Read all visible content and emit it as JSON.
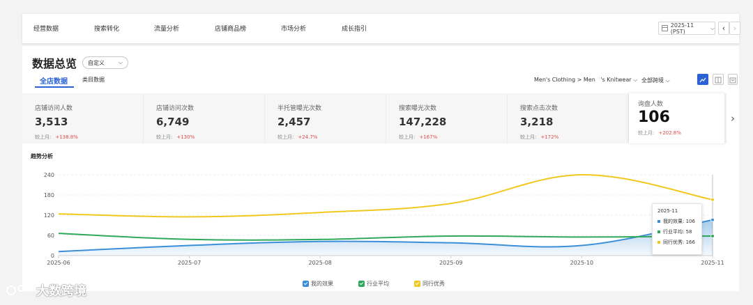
{
  "nav": {
    "tabs": [
      "经营数据",
      "搜索转化",
      "流量分析",
      "店铺商品榜",
      "市场分析",
      "成长指引"
    ],
    "month_picker": "2025-11 (PST)",
    "prev_label": "‹",
    "next_label": "›"
  },
  "header": {
    "title": "数据总览",
    "range_select": "自定义",
    "sub_tabs": [
      "全店数据",
      "类目数据"
    ],
    "category_filter": "Men's Clothing > Men   's Knitwear",
    "cross_filter": "全部跨境"
  },
  "metrics": [
    {
      "label": "店铺访问人数",
      "value": "3,513",
      "compare_label": "较上月:",
      "change": "+138.8%"
    },
    {
      "label": "店铺访问次数",
      "value": "6,749",
      "compare_label": "较上月:",
      "change": "+130%"
    },
    {
      "label": "半托管曝光次数",
      "value": "2,457",
      "compare_label": "较上月:",
      "change": "+24.7%"
    },
    {
      "label": "搜索曝光次数",
      "value": "147,228",
      "compare_label": "较上月:",
      "change": "+167%"
    },
    {
      "label": "搜索点击次数",
      "value": "3,218",
      "compare_label": "较上月:",
      "change": "+172%"
    },
    {
      "label": "询盘人数",
      "value": "106",
      "compare_label": "较上月:",
      "change": "+202.8%"
    }
  ],
  "metric_next_label": "›",
  "trend": {
    "title": "趋势分析"
  },
  "colors": {
    "mine": "#3b8fd8",
    "industry": "#2ea85a",
    "peer": "#f2c81f",
    "accent": "#2a62d4",
    "up": "#e24a4a"
  },
  "chart_data": {
    "type": "line",
    "x": [
      "2025-06",
      "2025-07",
      "2025-08",
      "2025-09",
      "2025-10",
      "2025-11"
    ],
    "ylim": [
      0,
      240
    ],
    "yticks": [
      0,
      60,
      120,
      180,
      240
    ],
    "grid": true,
    "legend_position": "bottom",
    "series": [
      {
        "name": "我的效果",
        "values": [
          12,
          30,
          42,
          38,
          30,
          106
        ],
        "color": "#3b8fd8",
        "area": true
      },
      {
        "name": "行业平均",
        "values": [
          66,
          48,
          48,
          58,
          55,
          58
        ],
        "color": "#2ea85a"
      },
      {
        "name": "同行优秀",
        "values": [
          124,
          115,
          128,
          155,
          240,
          166
        ],
        "color": "#f2c81f"
      }
    ],
    "tooltip": {
      "title": "2025-11",
      "rows": [
        {
          "label": "我的效果:",
          "value": "106"
        },
        {
          "label": "行业平均:",
          "value": "58"
        },
        {
          "label": "同行优秀:",
          "value": "166"
        }
      ]
    }
  },
  "watermark": "大数跨境"
}
